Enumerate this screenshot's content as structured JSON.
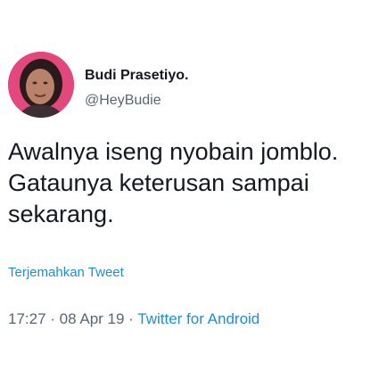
{
  "tweet": {
    "author_name": "Budi Prasetiyo.",
    "author_handle": "@HeyBudie",
    "text_lines": [
      "Awalnya iseng nyobain jomblo.",
      "Gataunya keterusan sampai",
      "sekarang."
    ],
    "translate_label": "Terjemahkan Tweet",
    "time": "17:27",
    "separator": " · ",
    "date": "08 Apr 19",
    "source": "Twitter for Android"
  },
  "colors": {
    "avatar_bg": "#e2487c",
    "link": "#1d8ed8",
    "secondary_text": "#586674",
    "primary_text": "#141823"
  }
}
